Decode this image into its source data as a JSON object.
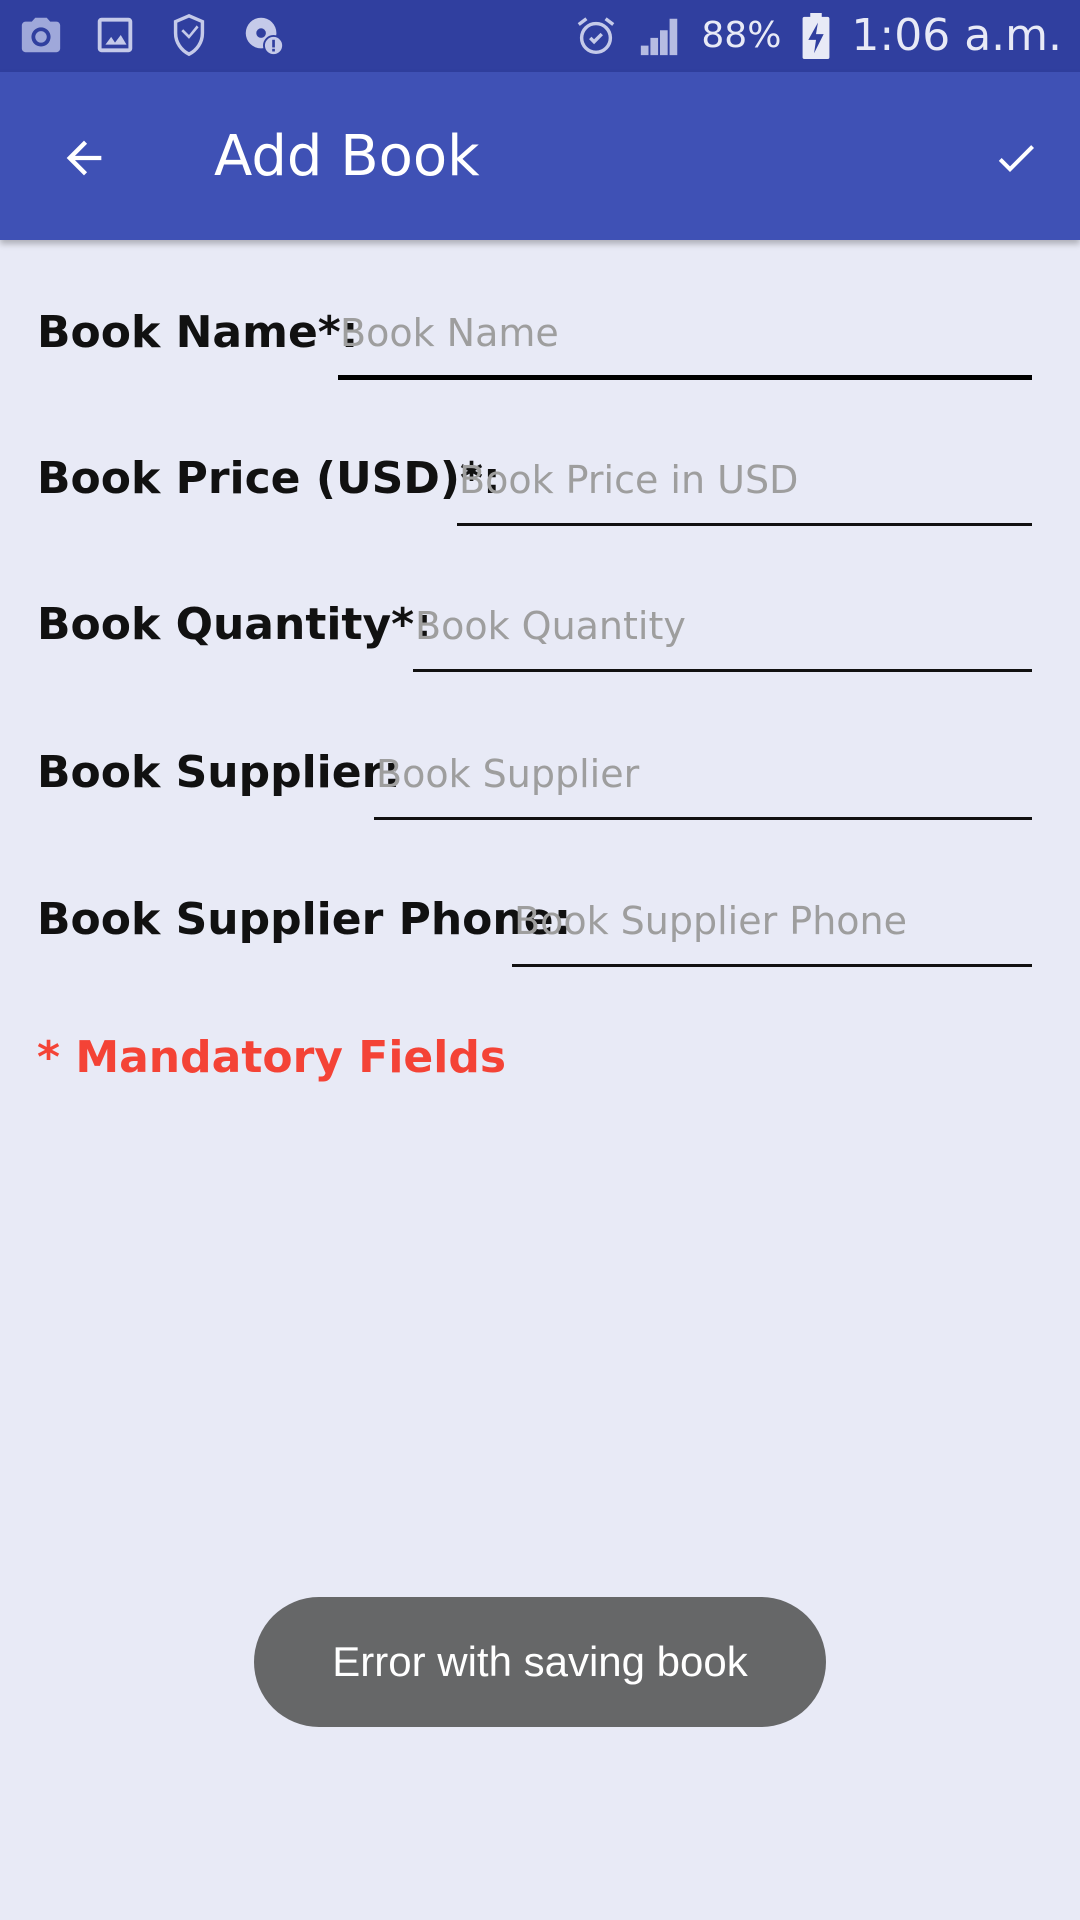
{
  "status_bar": {
    "left_icons": [
      "camera-icon",
      "image-icon",
      "shield-app-icon",
      "sync-alert-icon"
    ],
    "right_icons": [
      "alarm-icon",
      "signal-icon",
      "battery-charging-icon"
    ],
    "battery": "88%",
    "time": "1:06 a.m."
  },
  "app_bar": {
    "title": "Add Book",
    "back_icon": "arrow-back-icon",
    "save_icon": "check-icon",
    "color": "#3F51B5"
  },
  "form": {
    "fields": [
      {
        "label": "Book Name*:",
        "placeholder": "Book Name",
        "value": ""
      },
      {
        "label": "Book Price (USD)*:",
        "placeholder": "Book Price in USD",
        "value": ""
      },
      {
        "label": "Book Quantity*:",
        "placeholder": "Book Quantity",
        "value": ""
      },
      {
        "label": "Book Supplier:",
        "placeholder": "Book Supplier",
        "value": ""
      },
      {
        "label": "Book Supplier Phone:",
        "placeholder": "Book Supplier Phone",
        "value": ""
      }
    ],
    "mandatory_note": "* Mandatory Fields",
    "mandatory_color": "#F44336"
  },
  "toast": {
    "message": "Error with saving book"
  }
}
